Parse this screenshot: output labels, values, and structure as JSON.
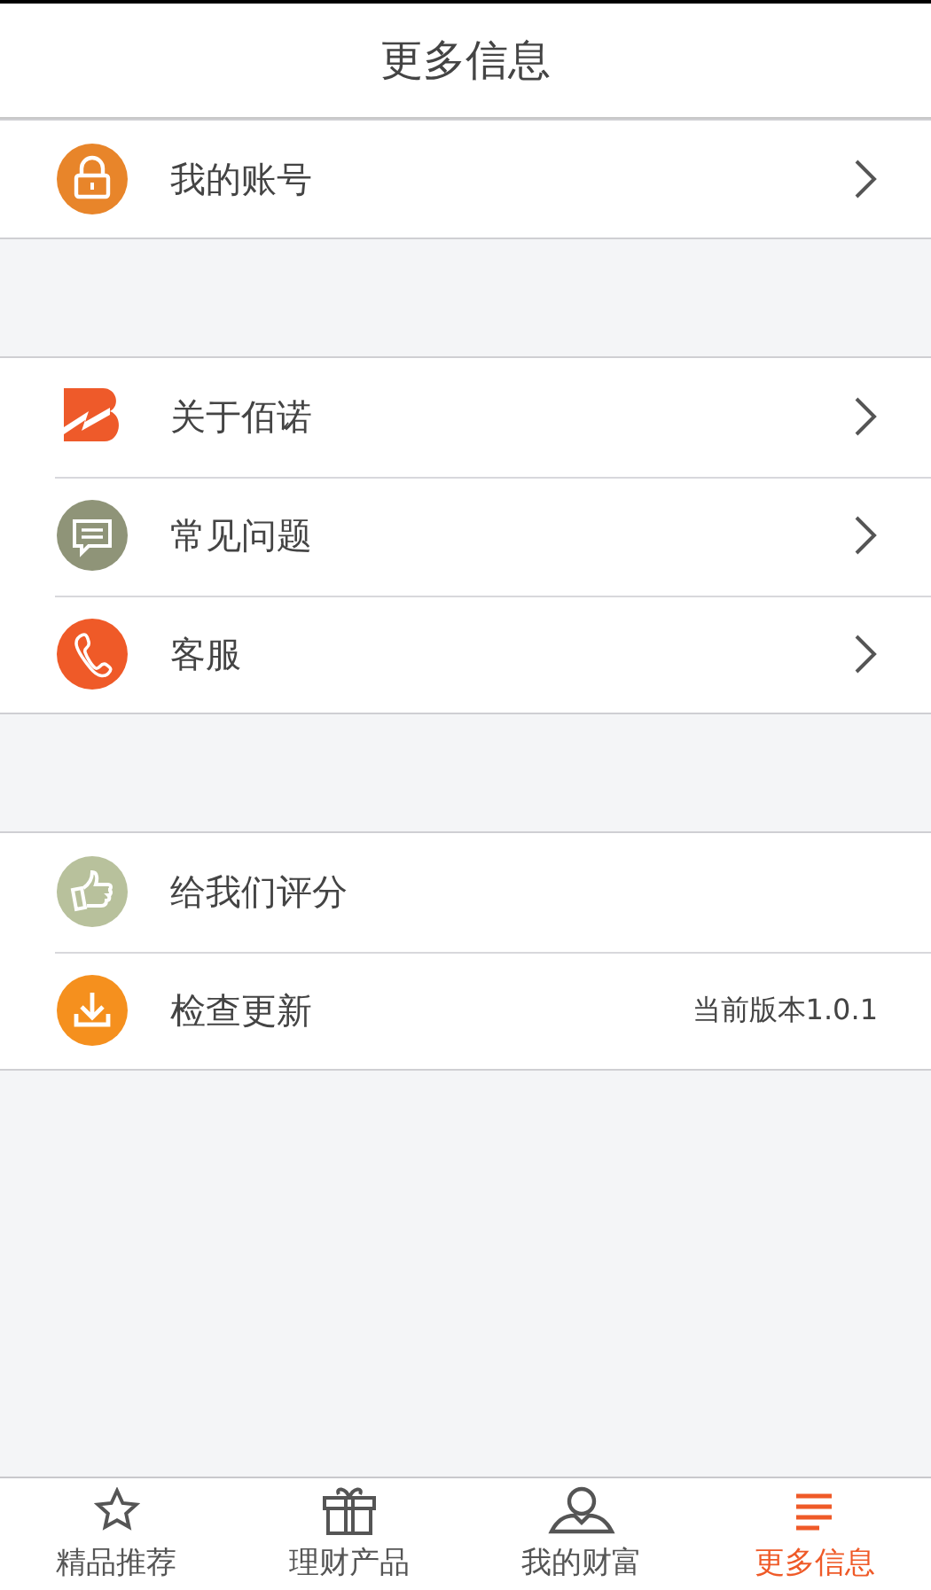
{
  "title": "更多信息",
  "groups": [
    {
      "items": [
        {
          "kind": "lock",
          "label": "我的账号",
          "arrow": true
        }
      ]
    },
    {
      "items": [
        {
          "kind": "brand",
          "label": "关于佰诺",
          "arrow": true
        },
        {
          "kind": "chat",
          "label": "常见问题",
          "arrow": true
        },
        {
          "kind": "phone",
          "label": "客服",
          "arrow": true
        }
      ]
    },
    {
      "items": [
        {
          "kind": "thumb",
          "label": "给我们评分",
          "arrow": false
        },
        {
          "kind": "download",
          "label": "检查更新",
          "arrow": false,
          "detail": "当前版本1.0.1"
        }
      ]
    }
  ],
  "tabs": [
    {
      "kind": "star",
      "label": "精品推荐",
      "selected": false
    },
    {
      "kind": "gift",
      "label": "理财产品",
      "selected": false
    },
    {
      "kind": "person",
      "label": "我的财富",
      "selected": false
    },
    {
      "kind": "menu",
      "label": "更多信息",
      "selected": true
    }
  ]
}
